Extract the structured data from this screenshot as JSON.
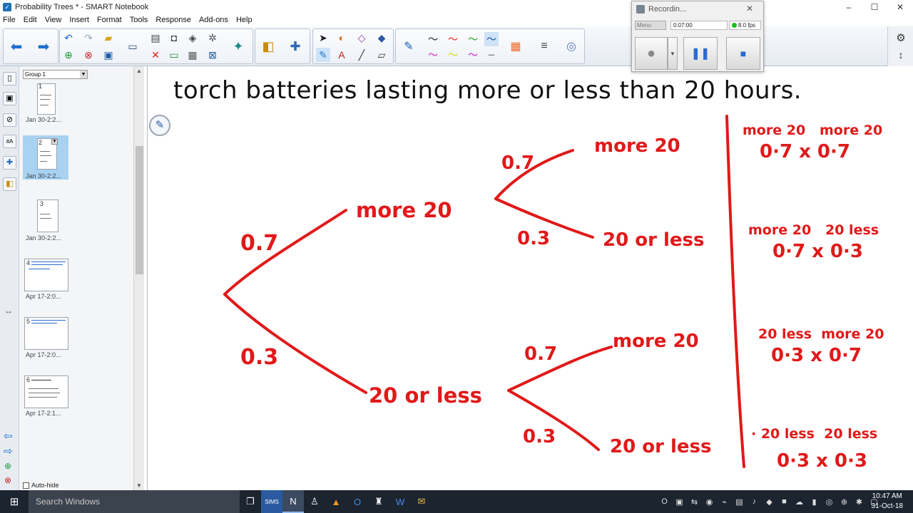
{
  "window": {
    "title": "Probability Trees * - SMART Notebook",
    "controls": [
      "–",
      "☐",
      "✕"
    ]
  },
  "menu": [
    "File",
    "Edit",
    "View",
    "Insert",
    "Format",
    "Tools",
    "Response",
    "Add-ons",
    "Help"
  ],
  "sorter": {
    "group": "Group 1",
    "pages": [
      {
        "num": "1",
        "caption": "Jan  30-2:2..."
      },
      {
        "num": "2",
        "caption": "Jan  30-2:2..."
      },
      {
        "num": "3",
        "caption": "Jan  30-2:2..."
      },
      {
        "num": "4",
        "caption": "Apr  17-2:0..."
      },
      {
        "num": "5",
        "caption": "Apr  17-2:0..."
      },
      {
        "num": "6",
        "caption": "Apr  17-2:1..."
      }
    ],
    "autohide": "Auto-hide"
  },
  "canvas": {
    "heading": "torch batteries lasting more or less than 20 hours."
  },
  "tree": {
    "first": [
      {
        "prob": "0.7",
        "label": "more 20"
      },
      {
        "prob": "0.3",
        "label": "20 or less"
      }
    ],
    "second": [
      {
        "prob": "0.7",
        "label": "more 20"
      },
      {
        "prob": "0.3",
        "label": "20 or less"
      },
      {
        "prob": "0.7",
        "label": "more 20"
      },
      {
        "prob": "0.3",
        "label": "20 or less"
      }
    ],
    "outcomes": [
      {
        "pair": "more 20   more 20",
        "calc": "0·7 x 0·7"
      },
      {
        "pair": "more 20   20 less",
        "calc": "0·7 x 0·3"
      },
      {
        "pair": "20 less  more 20",
        "calc": "0·3 x 0·7"
      },
      {
        "pair": "· 20 less  20 less",
        "calc": "0·3 x 0·3"
      }
    ],
    "ink_color": "#e11919"
  },
  "recorder": {
    "title": "Recordin...",
    "menu": "Menu",
    "time": "0:07:00",
    "fps": "8.0 fps"
  },
  "taskbar": {
    "search_placeholder": "Search Windows",
    "apps": [
      "❐",
      "SIMS",
      "N",
      "♙",
      "▲",
      "O",
      "♜",
      "W",
      "✉"
    ],
    "tray": [
      "O",
      "▣",
      "⇆",
      "◉",
      "⌁",
      "▤",
      "♪",
      "◆",
      "■",
      "☁",
      "▮",
      "◎",
      "⊕",
      "✱",
      "▢"
    ],
    "time": "10:47 AM",
    "date": "31-Oct-18"
  }
}
